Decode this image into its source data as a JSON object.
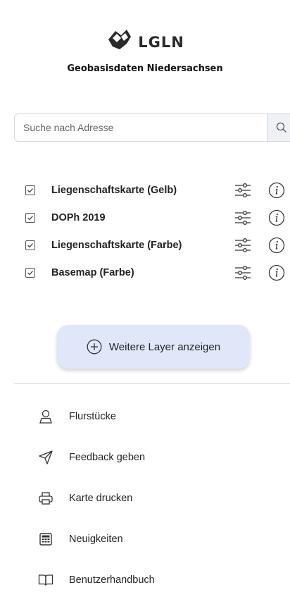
{
  "header": {
    "logo_text": "LGLN",
    "subtitle": "Geobasisdaten Niedersachsen"
  },
  "search": {
    "placeholder": "Suche nach Adresse"
  },
  "layers": [
    {
      "label": "Liegenschaftskarte (Gelb)",
      "checked": true
    },
    {
      "label": "DOPh 2019",
      "checked": true
    },
    {
      "label": "Liegenschaftskarte (Farbe)",
      "checked": true
    },
    {
      "label": "Basemap (Farbe)",
      "checked": true
    }
  ],
  "more_layers": {
    "label": "Weitere Layer anzeigen"
  },
  "menu": [
    {
      "label": "Flurstücke",
      "icon": "user-pin-icon"
    },
    {
      "label": "Feedback geben",
      "icon": "send-icon"
    },
    {
      "label": "Karte drucken",
      "icon": "printer-icon"
    },
    {
      "label": "Neuigkeiten",
      "icon": "newspaper-icon"
    },
    {
      "label": "Benutzerhandbuch",
      "icon": "book-icon"
    }
  ]
}
